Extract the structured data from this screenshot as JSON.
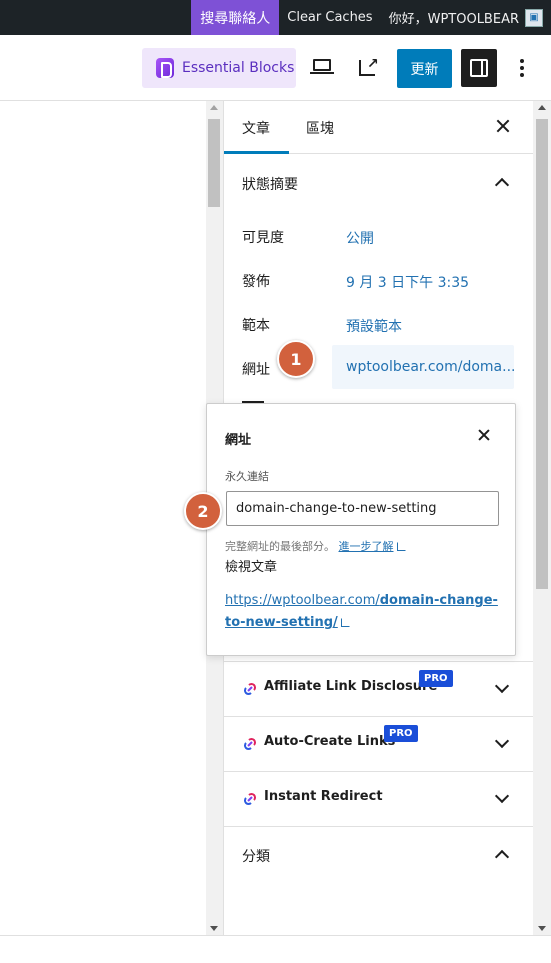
{
  "admin_bar": {
    "contact": "搜尋聯絡人",
    "clear_caches": "Clear Caches",
    "greeting": "你好，WPTOOLBEAR"
  },
  "toolbar": {
    "essential_blocks": "Essential Blocks",
    "update": "更新"
  },
  "sidebar": {
    "tab_post": "文章",
    "tab_block": "區塊",
    "summary_title": "狀態摘要",
    "rows": [
      {
        "label": "可見度",
        "value": "公開"
      },
      {
        "label": "發佈",
        "value": "9 月 3 日下午 3:35"
      },
      {
        "label": "範本",
        "value": "預設範本"
      },
      {
        "label": "網址",
        "value": "wptoolbear.com/doma..."
      }
    ],
    "plugins": [
      {
        "label": "Affiliate Link Disclosure",
        "badge": "PRO"
      },
      {
        "label": "Auto-Create Links",
        "badge": "PRO"
      },
      {
        "label": "Instant Redirect",
        "badge": ""
      }
    ],
    "category_title": "分類"
  },
  "popover": {
    "title": "網址",
    "permalink_label": "永久連結",
    "slug": "domain-change-to-new-setting",
    "help_text": "完整網址的最後部分。",
    "help_link": "進一步了解",
    "view_post": "檢視文章",
    "full_url_prefix": "https://wptoolbear.com/",
    "full_url_slug": "domain-change-to-new-setting/"
  },
  "annotations": {
    "step1": "1",
    "step2": "2"
  },
  "colors": {
    "admin_bar": "#1d2327",
    "contact_bg": "#7e51d6",
    "primary": "#007cba",
    "link": "#2271b1",
    "badge": "#d2613d",
    "pro": "#1a4ed8"
  }
}
